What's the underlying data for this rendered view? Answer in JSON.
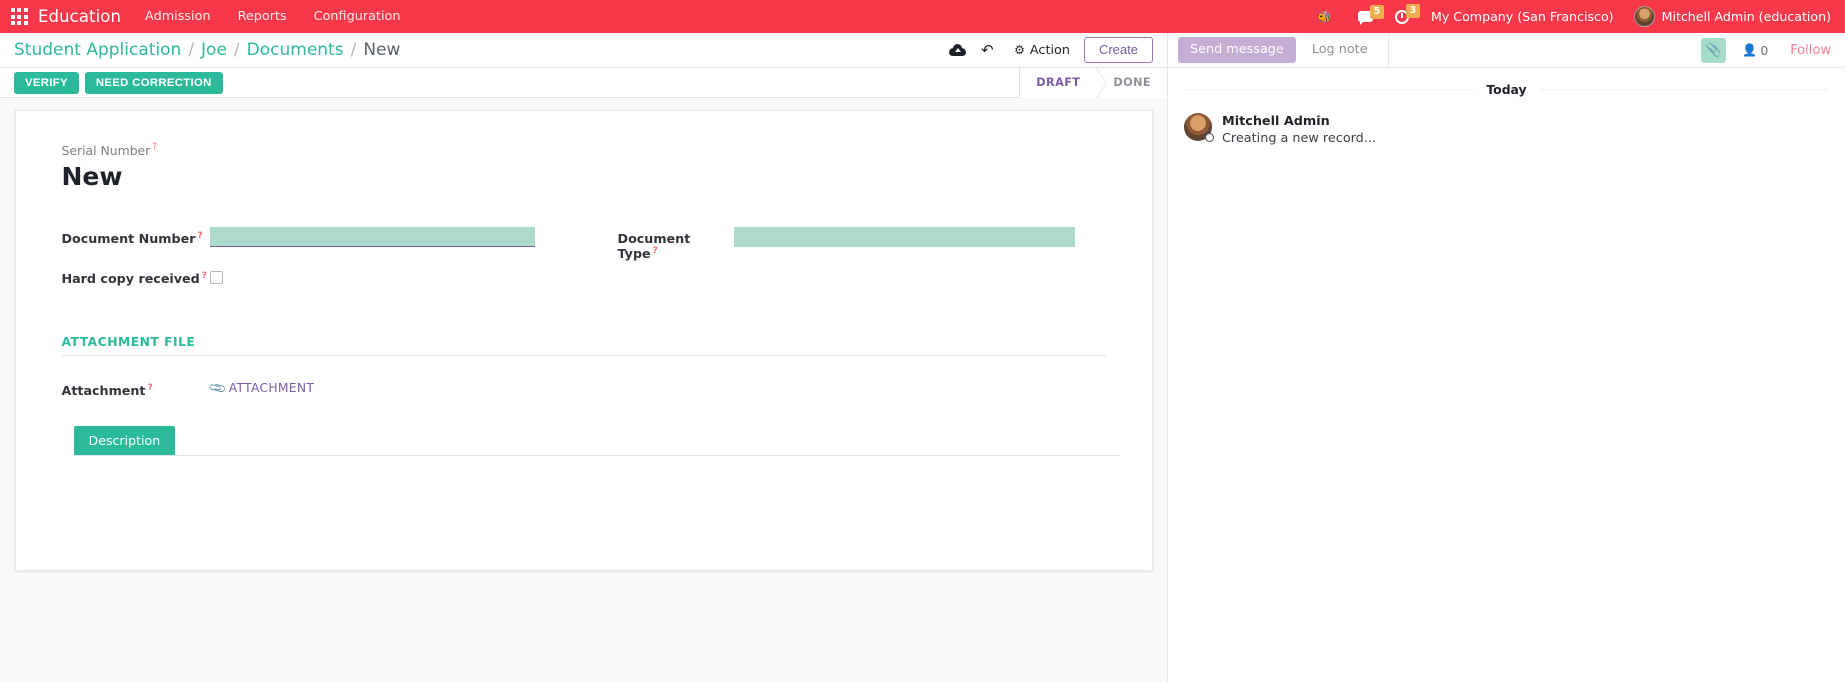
{
  "navbar": {
    "apps_icon": "apps-grid-icon",
    "brand": "Education",
    "menus": [
      {
        "label": "Admission"
      },
      {
        "label": "Reports"
      },
      {
        "label": "Configuration"
      }
    ],
    "bug_icon": "bug-icon",
    "messages": {
      "icon": "chat-bubble-icon",
      "count": "5"
    },
    "activities": {
      "icon": "clock-icon",
      "count": "3"
    },
    "company": "My Company (San Francisco)",
    "user": "Mitchell Admin (education)",
    "avatar_icon": "user-avatar"
  },
  "control_panel": {
    "breadcrumb": [
      {
        "label": "Student Application",
        "active": false
      },
      {
        "label": "Joe",
        "active": false
      },
      {
        "label": "Documents",
        "active": false
      },
      {
        "label": "New",
        "active": true
      }
    ],
    "separator": "/",
    "save_icon": "cloud-upload-icon",
    "discard_icon": "undo-icon",
    "action_icon": "gear-icon",
    "action_label": "Action",
    "create_label": "Create"
  },
  "statusbar": {
    "buttons": [
      {
        "label": "VERIFY"
      },
      {
        "label": "NEED CORRECTION"
      }
    ],
    "stages": [
      {
        "label": "DRAFT",
        "active": true
      },
      {
        "label": "DONE",
        "active": false
      }
    ]
  },
  "form": {
    "serial_number_label": "Serial Number",
    "tooltip_marker": "?",
    "record_title": "New",
    "fields": {
      "document_number": {
        "label": "Document Number",
        "value": "",
        "placeholder": ""
      },
      "document_type": {
        "label": "Document Type",
        "value": "",
        "placeholder": ""
      },
      "hard_copy_received": {
        "label": "Hard copy received",
        "checked": false
      }
    },
    "section": {
      "title": "ATTACHMENT FILE",
      "attachment_label": "Attachment",
      "attachment_link": "ATTACHMENT",
      "clip_icon": "paperclip-icon"
    },
    "notebook": {
      "tabs": [
        {
          "label": "Description",
          "active": true
        }
      ]
    }
  },
  "chatter": {
    "send_message_label": "Send message",
    "log_note_label": "Log note",
    "attach_icon": "paperclip-icon",
    "followers_icon": "person-icon",
    "followers_count": "0",
    "follow_label": "Follow",
    "day_separator": "Today",
    "messages": [
      {
        "author": "Mitchell Admin",
        "body": "Creating a new record...",
        "avatar_icon": "user-avatar"
      }
    ]
  },
  "colors": {
    "brand_red": "#f6384a",
    "accent_green": "#2bbb9b",
    "accent_purple": "#7d5ba6",
    "field_highlight": "#addbcb",
    "badge_orange": "#f0ad4e",
    "follow_pink": "#f77c96"
  }
}
